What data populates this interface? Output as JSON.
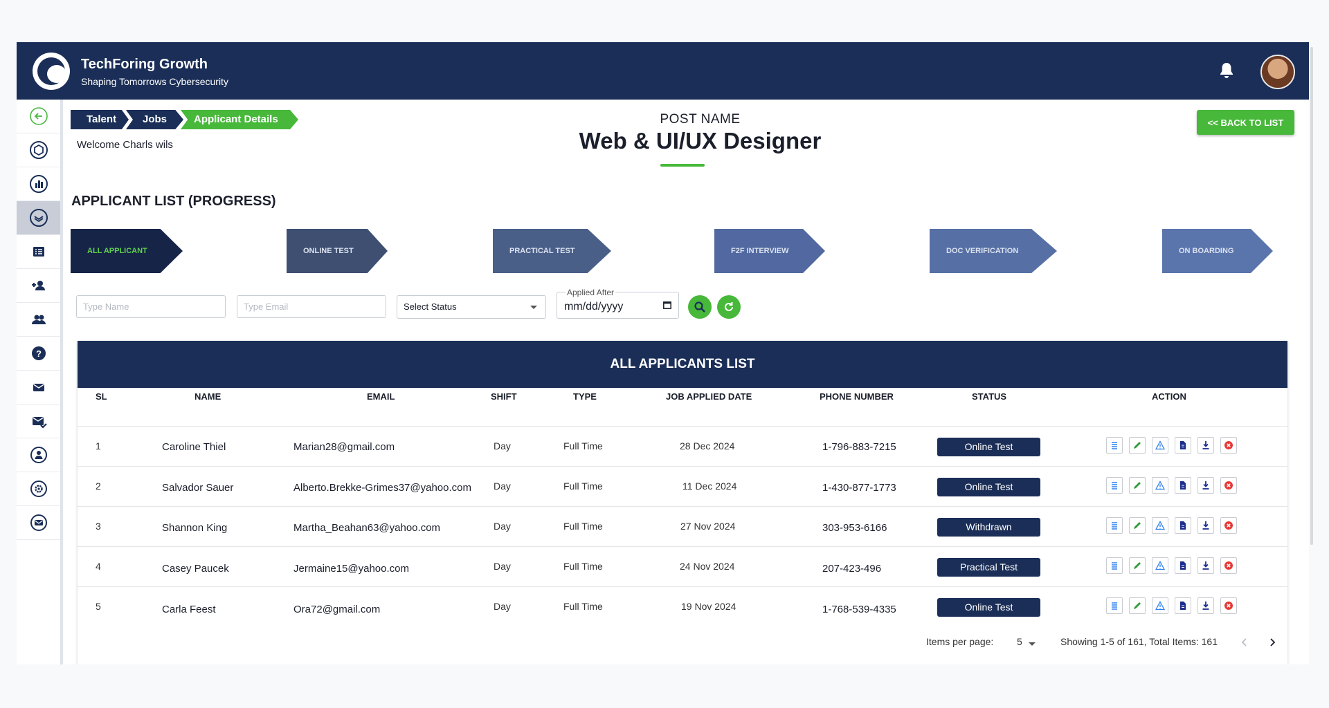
{
  "brand": {
    "title": "TechForing Growth",
    "subtitle": "Shaping Tomorrows Cybersecurity"
  },
  "breadcrumb": [
    "Talent",
    "Jobs",
    "Applicant Details"
  ],
  "welcome": "Welcome Charls wils",
  "post": {
    "label": "POST NAME",
    "name": "Web & UI/UX Designer"
  },
  "back_button": "<< BACK TO LIST",
  "section_title": "APPLICANT LIST (PROGRESS)",
  "steps": [
    "ALL APPLICANT",
    "ONLINE TEST",
    "PRACTICAL TEST",
    "F2F INTERVIEW",
    "DOC VERIFICATION",
    "ON BOARDING"
  ],
  "filters": {
    "name_placeholder": "Type Name",
    "email_placeholder": "Type Email",
    "status_value": "Select Status",
    "date_label": "Applied After",
    "date_value": "mm/dd/yyyy"
  },
  "table": {
    "title": "ALL APPLICANTS LIST",
    "headers": [
      "SL",
      "NAME",
      "EMAIL",
      "SHIFT",
      "TYPE",
      "JOB APPLIED DATE",
      "PHONE NUMBER",
      "STATUS",
      "ACTION"
    ],
    "rows": [
      {
        "sl": "1",
        "name": "Caroline Thiel",
        "email": "Marian28@gmail.com",
        "shift": "Day",
        "type": "Full Time",
        "date": "28 Dec 2024",
        "phone": "1-796-883-7215",
        "status": "Online Test"
      },
      {
        "sl": "2",
        "name": "Salvador Sauer",
        "email": "Alberto.Brekke-Grimes37@yahoo.com",
        "shift": "Day",
        "type": "Full Time",
        "date": "11 Dec 2024",
        "phone": "1-430-877-1773",
        "status": "Online Test"
      },
      {
        "sl": "3",
        "name": "Shannon King",
        "email": "Martha_Beahan63@yahoo.com",
        "shift": "Day",
        "type": "Full Time",
        "date": "27 Nov 2024",
        "phone": "303-953-6166",
        "status": "Withdrawn"
      },
      {
        "sl": "4",
        "name": "Casey Paucek",
        "email": "Jermaine15@yahoo.com",
        "shift": "Day",
        "type": "Full Time",
        "date": "24 Nov 2024",
        "phone": "207-423-496",
        "status": "Practical Test"
      },
      {
        "sl": "5",
        "name": "Carla Feest",
        "email": "Ora72@gmail.com",
        "shift": "Day",
        "type": "Full Time",
        "date": "19 Nov 2024",
        "phone": "1-768-539-4335",
        "status": "Online Test"
      }
    ]
  },
  "pagination": {
    "items_per_page_label": "Items per page:",
    "items_per_page": "5",
    "summary": "Showing 1-5 of 161, Total Items: 161"
  },
  "colors": {
    "navy": "#1a2e57",
    "green": "#47b83a",
    "step_dark": "#162448",
    "step_mid": "#3e4f72",
    "step_light": "#5a74a6"
  }
}
